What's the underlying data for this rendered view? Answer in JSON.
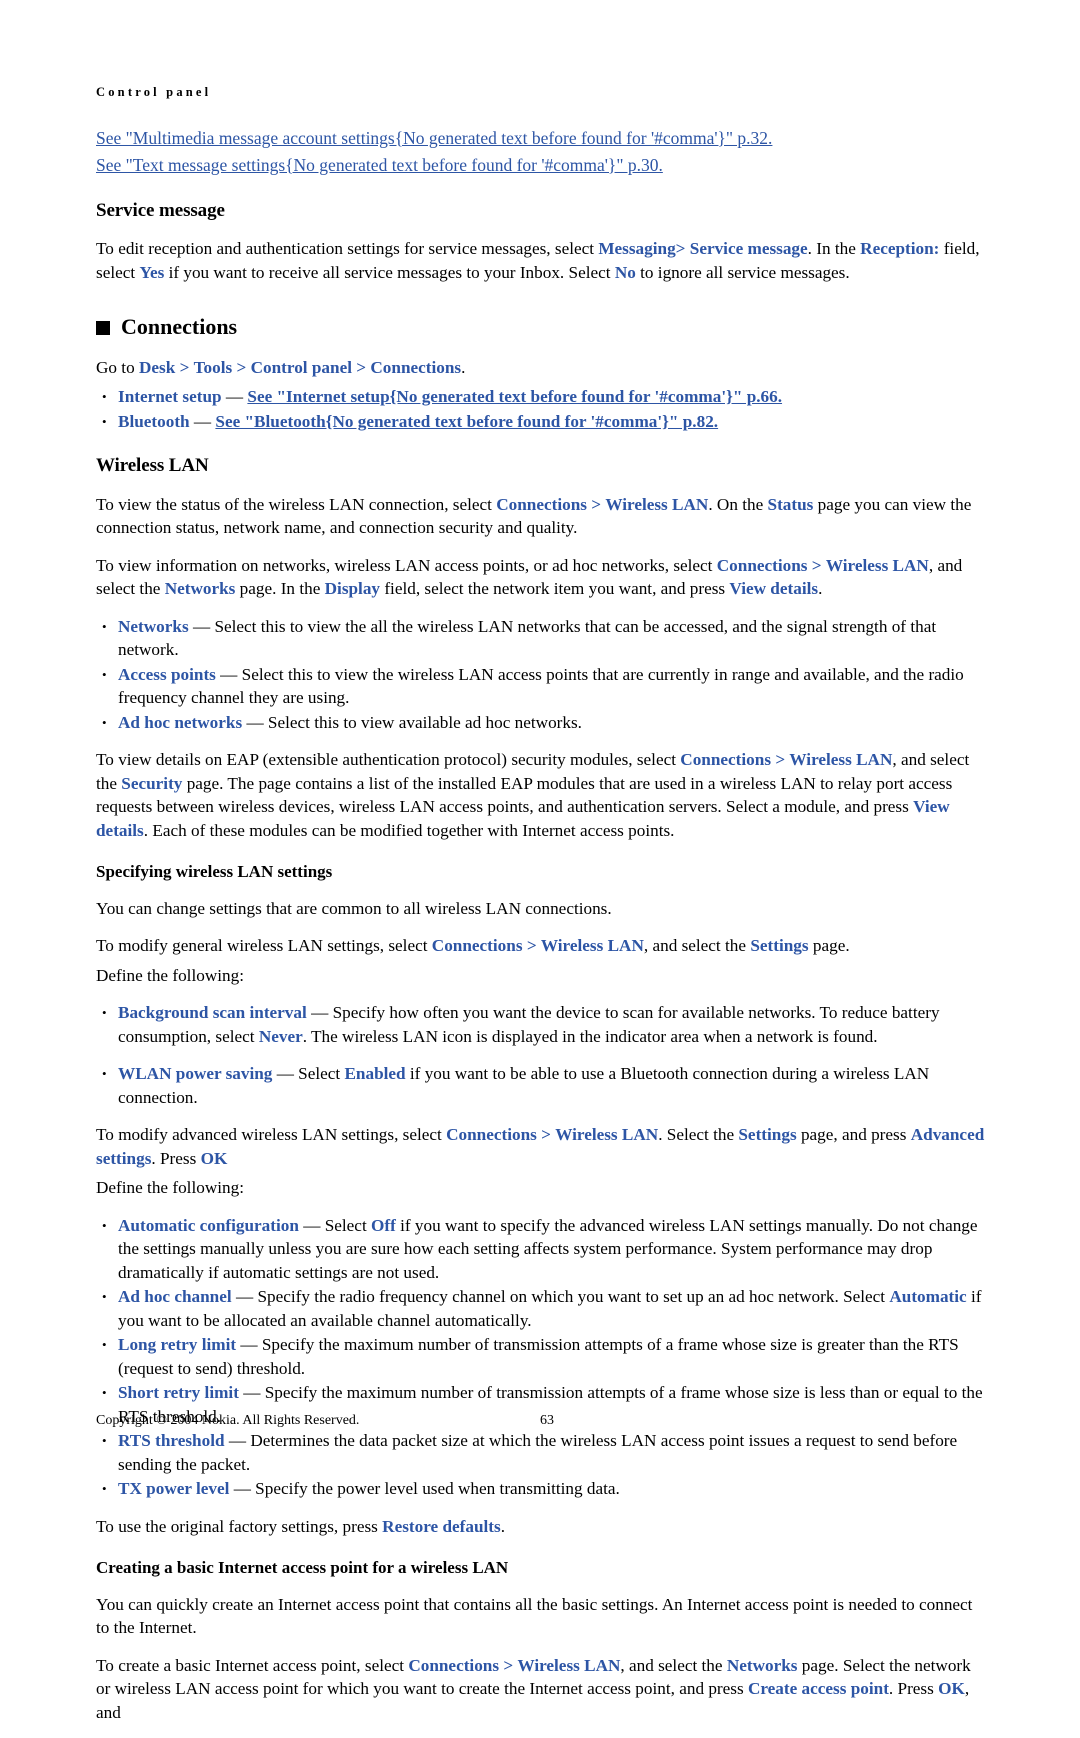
{
  "header": {
    "running_title": "Control panel"
  },
  "xrefs": [
    {
      "text": "See \"Multimedia message account settings{No generated text before found for '#comma'}\" p.32."
    },
    {
      "text": "See \"Text message settings{No generated text before found for '#comma'}\" p.30."
    }
  ],
  "service_message": {
    "heading": "Service message",
    "p1": {
      "a": "To edit reception and authentication settings for service messages, select ",
      "ui1": "Messaging",
      "gt1": ">",
      "ui2": "Service message",
      "b": ". In the ",
      "ui3": "Reception:",
      "c": " field, select ",
      "ui4": "Yes",
      "d": " if you want to receive all service messages to your Inbox. Select ",
      "ui5": "No",
      "e": " to ignore all service messages."
    }
  },
  "connections": {
    "heading": "Connections",
    "goto": {
      "a": "Go to ",
      "ui1": "Desk",
      "gt1": ">",
      "ui2": "Tools",
      "gt2": ">",
      "ui3": "Control panel",
      "gt3": ">",
      "ui4": "Connections",
      "b": "."
    },
    "bullets": [
      {
        "term": "Internet setup",
        "dash": " — ",
        "link": "See \"Internet setup{No generated text before found for '#comma'}\" p.66."
      },
      {
        "term": "Bluetooth",
        "dash": " — ",
        "link": "See \"Bluetooth{No generated text before found for '#comma'}\" p.82."
      }
    ]
  },
  "wireless_lan": {
    "heading": "Wireless LAN",
    "p_status": {
      "a": "To view the status of the wireless LAN connection, select ",
      "ui1": "Connections",
      "gt1": ">",
      "ui2": "Wireless LAN",
      "b": ". On the ",
      "ui3": "Status",
      "c": " page you can view the connection status, network name, and connection security and quality."
    },
    "p_networks": {
      "a": "To view information on networks, wireless LAN access points, or ad hoc networks, select ",
      "ui1": "Connections",
      "gt1": ">",
      "ui2": "Wireless LAN",
      "b": ", and select the ",
      "ui3": "Networks",
      "c": " page. In the ",
      "ui4": "Display",
      "d": " field, select the network item you want, and press ",
      "ui5": "View details",
      "e": "."
    },
    "bullets": [
      {
        "term": "Networks",
        "dash": " — ",
        "text": "Select this to view the all the wireless LAN networks that can be accessed, and the signal strength of that network."
      },
      {
        "term": "Access points",
        "dash": " — ",
        "text": "Select this to view the wireless LAN access points that are currently in range and available, and the radio frequency channel they are using."
      },
      {
        "term": "Ad hoc networks",
        "dash": " — ",
        "text": "Select this to view available ad hoc networks."
      }
    ],
    "p_eap": {
      "a": "To view details on EAP (extensible authentication protocol) security modules, select ",
      "ui1": "Connections",
      "gt1": ">",
      "ui2": "Wireless LAN",
      "b": ", and select the ",
      "ui3": "Security",
      "c": " page. The page contains a list of the installed EAP modules that are used in a wireless LAN to relay port access requests between wireless devices, wireless LAN access points, and authentication servers. Select a module, and press ",
      "ui4": "View details",
      "d": ". Each of these modules can be modified together with Internet access points."
    }
  },
  "specifying": {
    "heading": "Specifying wireless LAN settings",
    "p_common": "You can change settings that are common to all wireless LAN connections.",
    "p_modify": {
      "a": "To modify general wireless LAN settings, select ",
      "ui1": "Connections",
      "gt1": ">",
      "ui2": "Wireless LAN",
      "b": ", and select the ",
      "ui3": "Settings",
      "c": " page."
    },
    "p_define": "Define the following:",
    "bullets": [
      {
        "term": "Background scan interval",
        "dash": " — ",
        "a": "Specify how often you want the device to scan for available networks. To reduce battery consumption, select ",
        "ui1": "Never",
        "b": ". The wireless LAN icon is displayed in the indicator area when a network is found."
      },
      {
        "term": "WLAN power saving",
        "dash": " — ",
        "a": "Select ",
        "ui1": "Enabled",
        "b": " if you want to be able to use a Bluetooth connection during a wireless LAN connection."
      }
    ],
    "p_advanced": {
      "a": "To modify advanced wireless LAN settings, select ",
      "ui1": "Connections",
      "gt1": ">",
      "ui2": "Wireless LAN",
      "b": ". Select the ",
      "ui3": "Settings",
      "c": " page, and press ",
      "ui4": "Advanced settings",
      "d": ". Press ",
      "ui5": "OK"
    },
    "p_define2": "Define the following:",
    "adv_bullets": [
      {
        "term": "Automatic configuration",
        "dash": " — ",
        "a": "Select ",
        "ui1": "Off",
        "b": " if you want to specify the advanced wireless LAN settings manually. Do not change the settings manually unless you are sure how each setting affects system performance. System performance may drop dramatically if automatic settings are not used."
      },
      {
        "term": "Ad hoc channel",
        "dash": " — ",
        "a": "Specify the radio frequency channel on which you want to set up an ad hoc network. Select ",
        "ui1": "Automatic",
        "b": " if you want to be allocated an available channel automatically."
      },
      {
        "term": "Long retry limit",
        "dash": " — ",
        "a": "Specify the maximum number of transmission attempts of a frame whose size is greater than the RTS (request to send) threshold.",
        "ui1": "",
        "b": ""
      },
      {
        "term": "Short retry limit",
        "dash": " — ",
        "a": "Specify the maximum number of transmission attempts of a frame whose size is less than or equal to the RTS threshold.",
        "ui1": "",
        "b": ""
      },
      {
        "term": "RTS threshold",
        "dash": " — ",
        "a": "Determines the data packet size at which the wireless LAN access point issues a request to send before sending the packet.",
        "ui1": "",
        "b": ""
      },
      {
        "term": "TX power level",
        "dash": " — ",
        "a": "Specify the power level used when transmitting data.",
        "ui1": "",
        "b": ""
      }
    ],
    "p_restore": {
      "a": "To use the original factory settings, press ",
      "ui1": "Restore defaults",
      "b": "."
    }
  },
  "creating": {
    "heading": "Creating a basic Internet access point for a wireless LAN",
    "p_intro": "You can quickly create an Internet access point that contains all the basic settings. An Internet access point is needed to connect to the Internet.",
    "p_create": {
      "a": "To create a basic Internet access point, select ",
      "ui1": "Connections",
      "gt1": ">",
      "ui2": "Wireless LAN",
      "b": ", and select the ",
      "ui3": "Networks",
      "c": " page. Select the network or wireless LAN access point for which you want to create the Internet access point, and press ",
      "ui4": "Create access point",
      "d": ". Press ",
      "ui5": "OK",
      "e": ", and"
    }
  },
  "footer": {
    "copyright": "Copyright © 2004 Nokia. All Rights Reserved.",
    "page_number": "63"
  },
  "colors": {
    "link": "#2d55a5",
    "text": "#000000",
    "background": "#ffffff"
  }
}
